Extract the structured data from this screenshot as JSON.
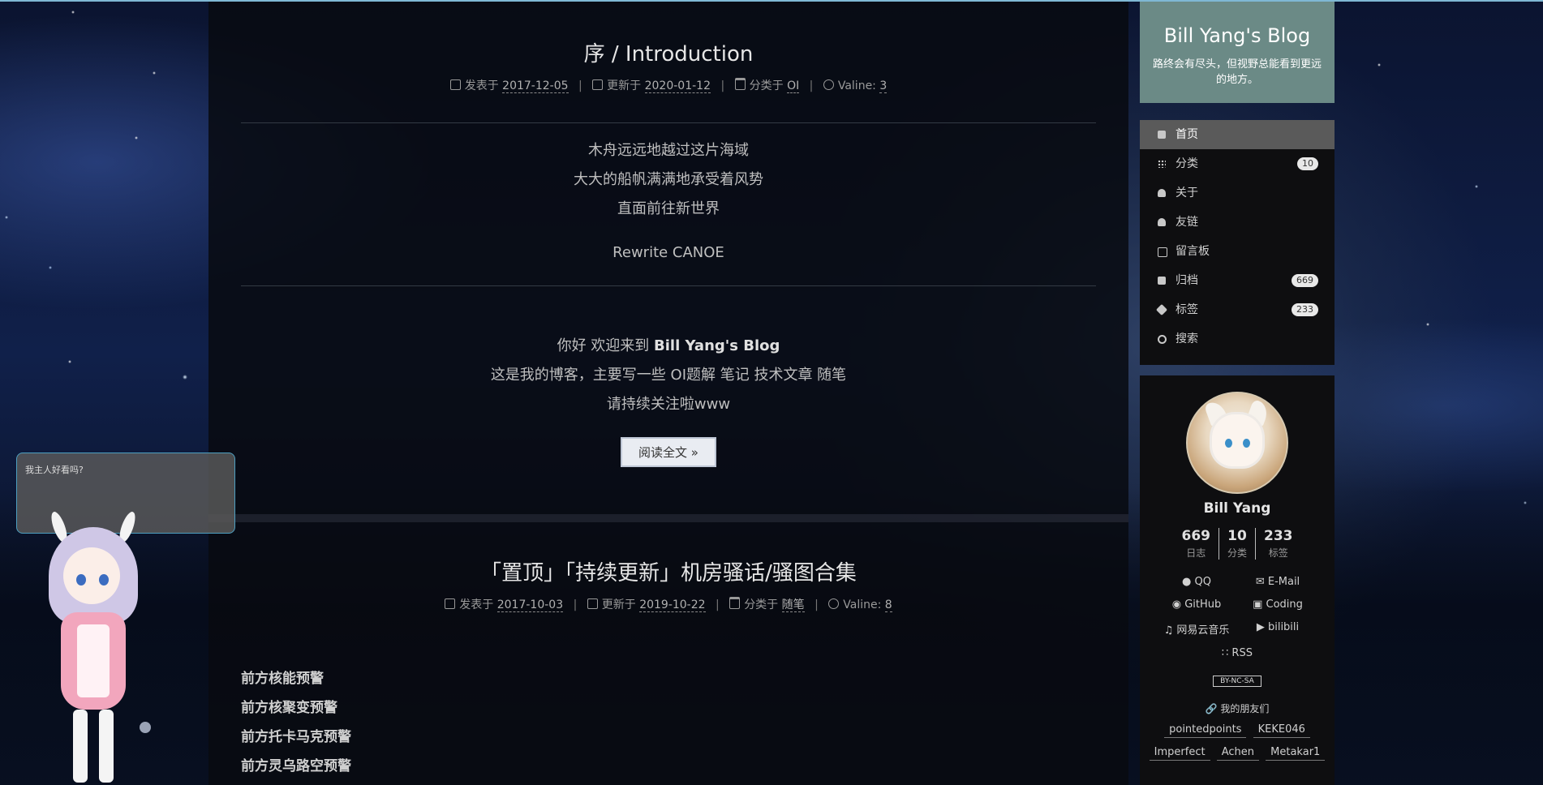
{
  "post1": {
    "title": "序 / Introduction",
    "posted_label": "发表于",
    "posted_date": "2017-12-05",
    "updated_label": "更新于",
    "updated_date": "2020-01-12",
    "category_label": "分类于",
    "category": "OI",
    "comments_label": "Valine:",
    "comments": "3",
    "poem": [
      "木舟远远地越过这片海域",
      "大大的船帆满满地承受着风势",
      "直面前往新世界"
    ],
    "rewrite": "Rewrite CANOE",
    "welcome_prefix": "你好 欢迎来到",
    "welcome_blog": "Bill Yang's Blog",
    "intro_line2": "这是我的博客，主要写一些 OI题解 笔记 技术文章 随笔",
    "intro_line3": "请持续关注啦www",
    "read_more": "阅读全文 »"
  },
  "post2": {
    "title": "「置顶」「持续更新」机房骚话/骚图合集",
    "posted_label": "发表于",
    "posted_date": "2017-10-03",
    "updated_label": "更新于",
    "updated_date": "2019-10-22",
    "category_label": "分类于",
    "category": "随笔",
    "comments_label": "Valine:",
    "comments": "8",
    "warnings": [
      "前方核能预警",
      "前方核聚变预警",
      "前方托卡马克预警",
      "前方灵乌路空预警"
    ]
  },
  "site": {
    "title": "Bill Yang's Blog",
    "subtitle": "路终会有尽头，但视野总能看到更远的地方。"
  },
  "menu": [
    {
      "label": "首页",
      "icon": "home-icon",
      "badge": null
    },
    {
      "label": "分类",
      "icon": "th-icon",
      "badge": "10"
    },
    {
      "label": "关于",
      "icon": "user-icon",
      "badge": null
    },
    {
      "label": "友链",
      "icon": "users-icon",
      "badge": null
    },
    {
      "label": "留言板",
      "icon": "sticky-note-icon",
      "badge": null
    },
    {
      "label": "归档",
      "icon": "archive-icon",
      "badge": "669"
    },
    {
      "label": "标签",
      "icon": "tags-icon",
      "badge": "233"
    },
    {
      "label": "搜索",
      "icon": "search-icon",
      "badge": null
    }
  ],
  "profile": {
    "name": "Bill Yang",
    "stats": [
      {
        "n": "669",
        "l": "日志"
      },
      {
        "n": "10",
        "l": "分类"
      },
      {
        "n": "233",
        "l": "标签"
      }
    ],
    "links": [
      "QQ",
      "E-Mail",
      "GitHub",
      "Coding",
      "网易云音乐",
      "bilibili"
    ],
    "rss": "RSS",
    "license": "BY-NC-SA",
    "friends_title": "我的朋友们",
    "friends_row1": [
      "pointedpoints",
      "KEKE046"
    ],
    "friends_row2": [
      "Imperfect",
      "Achen",
      "Metakar1"
    ]
  },
  "mascot": {
    "speech": "我主人好看吗?"
  },
  "colors": {
    "brand_bg": "#6b8a86",
    "menu_active": "#5a5a5a",
    "speech_border": "#4d9fc0"
  }
}
